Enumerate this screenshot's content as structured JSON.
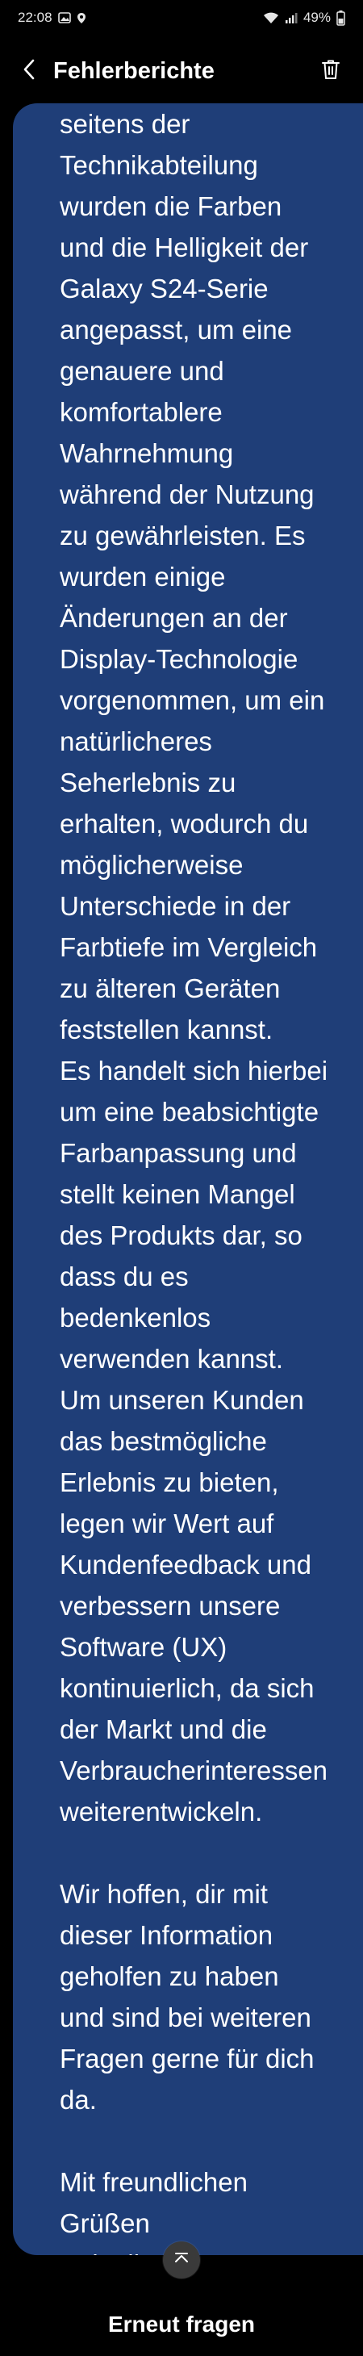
{
  "status_bar": {
    "time": "22:08",
    "battery": "49%"
  },
  "header": {
    "title": "Fehlerberichte"
  },
  "message": {
    "text": "seitens der\nTechnikabteilung\nwurden die Farben\nund die Helligkeit der\nGalaxy S24-Serie\nangepasst, um eine\ngenauere und\nkomfortablere\nWahrnehmung\nwährend der Nutzung\nzu gewährleisten. Es\nwurden einige\nÄnderungen an der\nDisplay-Technologie\nvorgenommen, um ein\nnatürlicheres\nSeherlebnis zu\nerhalten, wodurch du\nmöglicherweise\nUnterschiede in der\nFarbtiefe im Vergleich\nzu älteren Geräten\nfeststellen kannst.\nEs handelt sich hierbei\num eine beabsichtigte\nFarbanpassung und\nstellt keinen Mangel\ndes Produkts dar, so\ndass du es\nbedenkenlos\nverwenden kannst.\nUm unseren Kunden\ndas bestmögliche\nErlebnis zu bieten,\nlegen wir Wert auf\nKundenfeedback und\nverbessern unsere\nSoftware (UX)\nkontinuierlich, da sich\nder Markt und die\nVerbraucherinteressen\nweiterentwickeln.\n\nWir hoffen, dir mit\ndieser Information\ngeholfen zu haben\nund sind bei weiteren\nFragen gerne für dich\nda.\n\nMit freundlichen\nGrüßen\nAnja Illm"
  },
  "footer": {
    "retry_label": "Erneut fragen"
  },
  "colors": {
    "background": "#000000",
    "bubble": "#1f3e78",
    "text": "#ffffff"
  },
  "icons": {
    "back": "chevron-left-icon",
    "delete": "trash-icon",
    "scroll_top": "chevron-up-icon"
  }
}
